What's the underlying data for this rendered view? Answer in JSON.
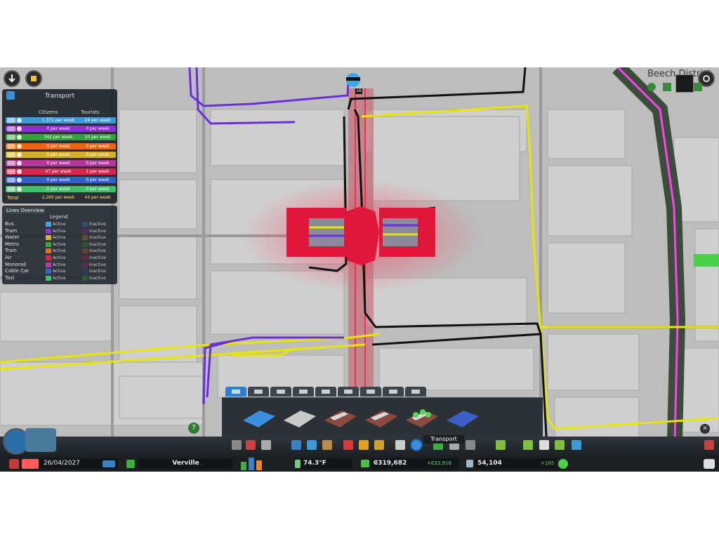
{
  "top_left": {
    "zoom_out_icon": "arrow-down-icon",
    "info_icon": "info-icon"
  },
  "district": {
    "name": "Beech District"
  },
  "transport_panel": {
    "title": "Transport",
    "col_citizens": "Citizens",
    "col_tourists": "Tourists",
    "rows": [
      {
        "type": "bus",
        "color": "#3b9bd6",
        "citizens": "1,371 per week",
        "tourists": "24 per week"
      },
      {
        "type": "tram",
        "color": "#8b2be2",
        "citizens": "0 per week",
        "tourists": "0 per week"
      },
      {
        "type": "metro",
        "color": "#2ea43a",
        "citizens": "342 per week",
        "tourists": "10 per week"
      },
      {
        "type": "train",
        "color": "#e06a1a",
        "citizens": "0 per week",
        "tourists": "0 per week"
      },
      {
        "type": "water",
        "color": "#d7b02a",
        "citizens": "0 per week",
        "tourists": "0 per week"
      },
      {
        "type": "monorail",
        "color": "#b03a9c",
        "citizens": "0 per week",
        "tourists": "0 per week"
      },
      {
        "type": "air",
        "color": "#d6284f",
        "citizens": "47 per week",
        "tourists": "1 per week"
      },
      {
        "type": "cable-car",
        "color": "#3360c8",
        "citizens": "0 per week",
        "tourists": "0 per week"
      },
      {
        "type": "taxi",
        "color": "#3fbf6a",
        "citizens": "0 per week",
        "tourists": "0 per week"
      }
    ],
    "total_label": "Total",
    "total_citizens": "2,260 per week",
    "total_tourists": "44 per week"
  },
  "lines_overview": {
    "title": "Lines Overview",
    "legend": "Legend",
    "rows": [
      {
        "name": "Bus",
        "active_color": "#4aa3e0",
        "inactive_color": "#2f5168",
        "active": "Active",
        "inactive": "Inactive"
      },
      {
        "name": "Tram",
        "active_color": "#8a35d8",
        "inactive_color": "#4a2c66",
        "active": "Active",
        "inactive": "Inactive"
      },
      {
        "name": "Water",
        "active_color": "#d6b339",
        "inactive_color": "#5e5330",
        "active": "Active",
        "inactive": "Inactive"
      },
      {
        "name": "Metro",
        "active_color": "#34a844",
        "inactive_color": "#2d5232",
        "active": "Active",
        "inactive": "Inactive"
      },
      {
        "name": "Train",
        "active_color": "#e2721f",
        "inactive_color": "#63432a",
        "active": "Active",
        "inactive": "Inactive"
      },
      {
        "name": "Air",
        "active_color": "#d42a52",
        "inactive_color": "#5e2b38",
        "active": "Active",
        "inactive": "Inactive"
      },
      {
        "name": "Monorail",
        "active_color": "#b63ca2",
        "inactive_color": "#572e50",
        "active": "Active",
        "inactive": "Inactive"
      },
      {
        "name": "Cable Car",
        "active_color": "#3a62cc",
        "inactive_color": "#2e3a5e",
        "active": "Active",
        "inactive": "Inactive"
      },
      {
        "name": "Taxi",
        "active_color": "#3fc06e",
        "inactive_color": "#2c5a3e",
        "active": "Active",
        "inactive": "Inactive"
      }
    ]
  },
  "map": {
    "chirper_badge": "16"
  },
  "build_panel": {
    "tabs": [
      "bus",
      "tram",
      "metro",
      "train",
      "ship",
      "plane",
      "monorail",
      "cable-car",
      "taxi"
    ],
    "items": [
      "transport-hub",
      "train-platform",
      "road-with-tram-1",
      "road-with-tram-2",
      "road-with-trees",
      "bus-stop-shelter"
    ]
  },
  "tooltip": {
    "text": "Transport"
  },
  "status_bar": {
    "date": "26/04/2027",
    "city_name": "Verville",
    "temperature": "74.3°F",
    "money": "₢319,682",
    "income": "+₢33,918",
    "population": "54,104",
    "population_change": "+165"
  },
  "colors": {
    "bus_line": "#e6e600",
    "metro_line": "#111111",
    "tram_line": "#6a2fd8",
    "monorail_line": "#ff3ff0",
    "hub": "#e0163b"
  }
}
